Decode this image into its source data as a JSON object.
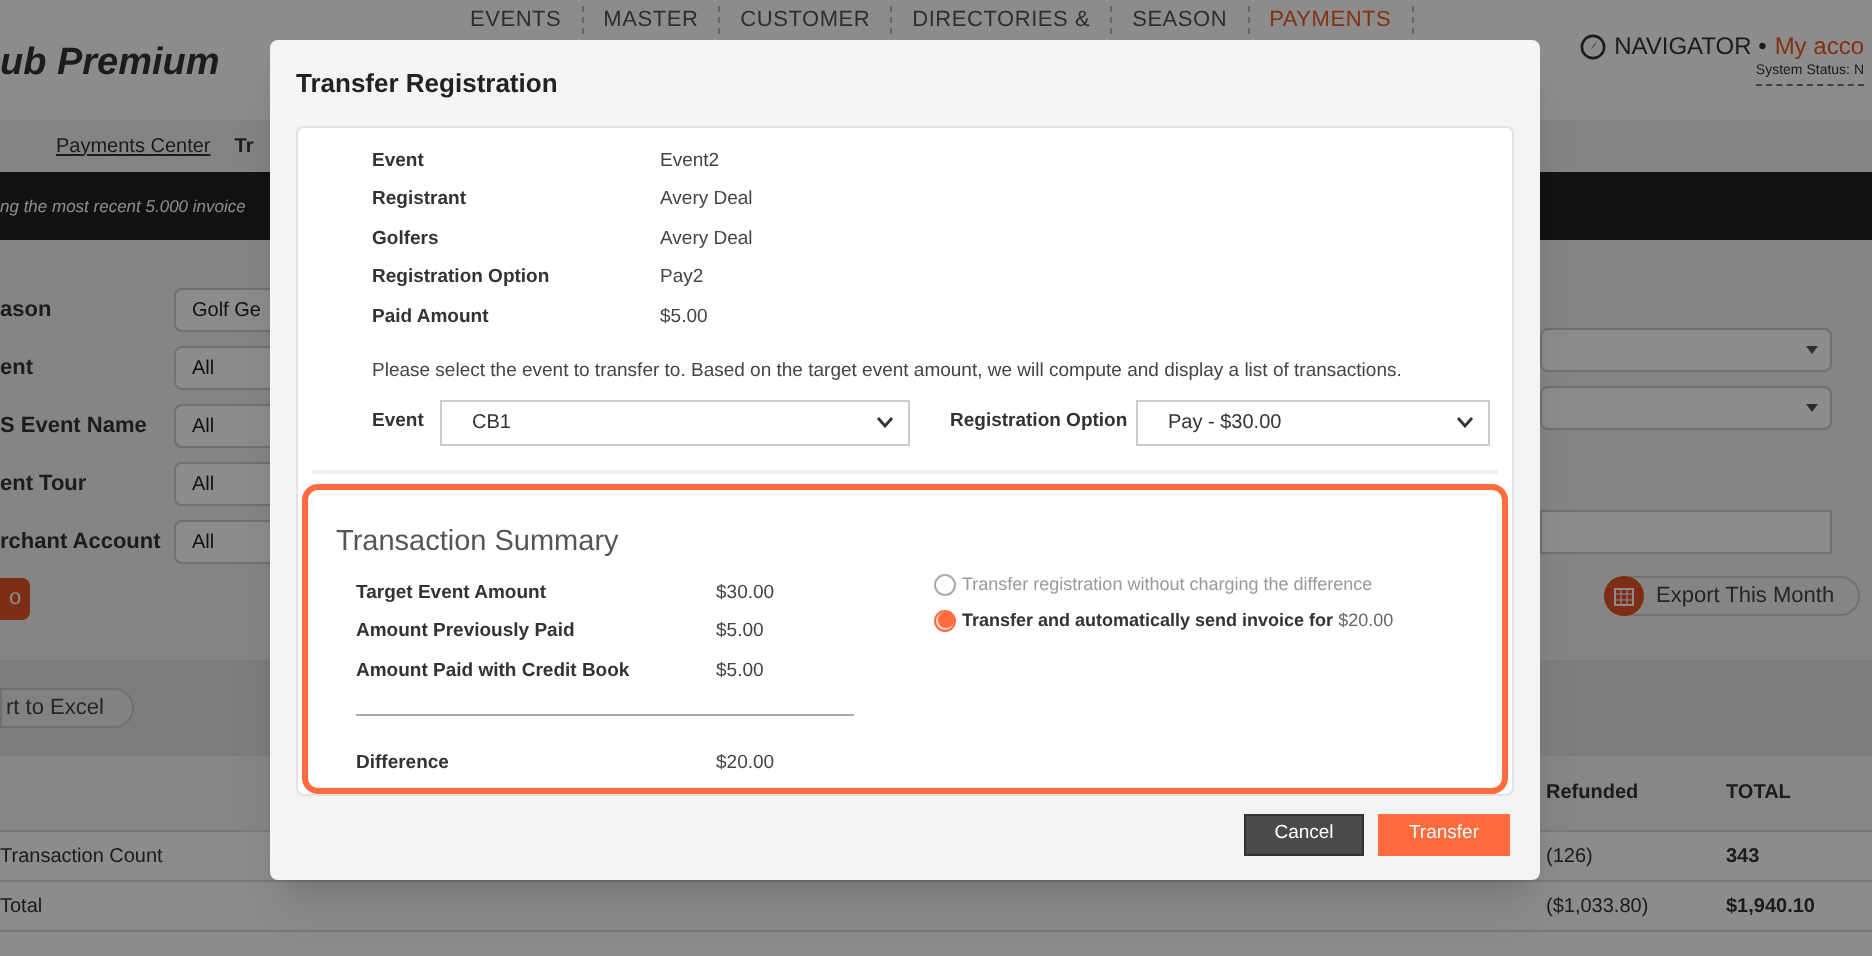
{
  "header": {
    "logo": "ub Premium",
    "nav": [
      {
        "label": "EVENTS",
        "selected": false
      },
      {
        "label": "MASTER",
        "selected": false
      },
      {
        "label": "CUSTOMER",
        "selected": false
      },
      {
        "label": "DIRECTORIES &",
        "selected": false
      },
      {
        "label": "SEASON",
        "selected": false
      },
      {
        "label": "PAYMENTS",
        "selected": true
      }
    ],
    "navigator": "NAVIGATOR •",
    "account": "My acco",
    "system_status": "System Status: N"
  },
  "breadcrumb": [
    "Payments Center",
    "Tr"
  ],
  "notice": "ng the most recent 5.000 invoice",
  "filters": [
    {
      "label": "ason",
      "value": "Golf Ge"
    },
    {
      "label": "ent",
      "value": "All"
    },
    {
      "label": "S Event Name",
      "value": "All"
    },
    {
      "label": "ent Tour",
      "value": "All"
    },
    {
      "label": "rchant Account",
      "value": "All"
    }
  ],
  "go_button": "o",
  "export_button": "Export This Month",
  "excel_button": "rt to Excel",
  "table": {
    "columns": [
      "Refunded",
      "TOTAL"
    ],
    "rows": [
      {
        "label": "Transaction Count",
        "refunded": "(126)",
        "total": "343"
      },
      {
        "label": "Total",
        "refunded": "($1,033.80)",
        "total": "$1,940.10"
      }
    ]
  },
  "modal": {
    "title": "Transfer Registration",
    "details": [
      {
        "label": "Event",
        "value": "Event2"
      },
      {
        "label": "Registrant",
        "value": "Avery Deal"
      },
      {
        "label": "Golfers",
        "value": "Avery Deal"
      },
      {
        "label": "Registration Option",
        "value": "Pay2"
      },
      {
        "label": "Paid Amount",
        "value": "$5.00"
      }
    ],
    "instruction": "Please select the event to transfer to. Based on the target event amount, we will compute and display a list of transactions.",
    "event_select": {
      "label": "Event",
      "value": "CB1"
    },
    "option_select": {
      "label": "Registration Option",
      "value": "Pay - $30.00"
    },
    "summary": {
      "title": "Transaction Summary",
      "rows": [
        {
          "label": "Target Event Amount",
          "value": "$30.00"
        },
        {
          "label": "Amount Previously Paid",
          "value": "$5.00"
        },
        {
          "label": "Amount Paid with Credit Book",
          "value": "$5.00"
        }
      ],
      "difference": {
        "label": "Difference",
        "value": "$20.00"
      },
      "options": [
        {
          "label": "Transfer registration without charging the difference",
          "selected": false
        },
        {
          "label": "Transfer and automatically send invoice for",
          "amount": "$20.00",
          "selected": true
        }
      ]
    },
    "buttons": [
      {
        "label": "Cancel",
        "kind": "secondary"
      },
      {
        "label": "Transfer",
        "kind": "primary"
      }
    ]
  }
}
